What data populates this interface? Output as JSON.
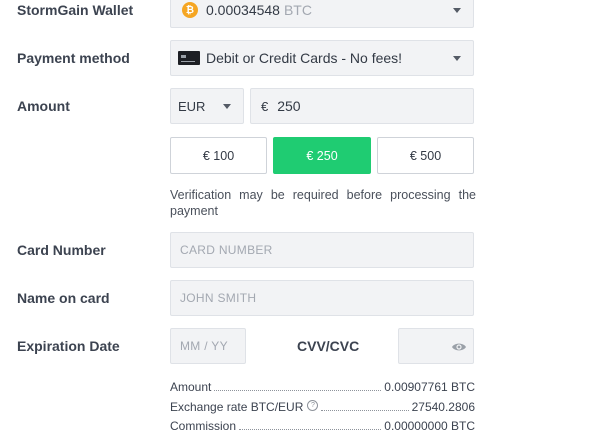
{
  "wallet": {
    "label": "StormGain Wallet",
    "coin_glyph": "₿",
    "balance": "0.00034548",
    "currency": "BTC"
  },
  "payment": {
    "label": "Payment method",
    "value": "Debit or Credit Cards - No fees!"
  },
  "amount": {
    "label": "Amount",
    "currency": "EUR",
    "symbol": "€",
    "value": "250",
    "presets": [
      "€ 100",
      "€ 250",
      "€ 500"
    ],
    "active_preset": 1
  },
  "note": "Verification may be required before processing the payment",
  "card_number": {
    "label": "Card Number",
    "placeholder": "CARD NUMBER"
  },
  "name_on_card": {
    "label": "Name on card",
    "placeholder": "JOHN SMITH"
  },
  "expiration": {
    "label": "Expiration Date",
    "placeholder": "MM / YY"
  },
  "cvv": {
    "label": "CVV/CVC"
  },
  "summary": {
    "amount_label": "Amount",
    "amount_value": "0.00907761 BTC",
    "rate_label": "Exchange rate BTC/EUR",
    "rate_value": "27540.2806",
    "commission_label": "Commission",
    "commission_value": "0.00000000 BTC"
  },
  "colors": {
    "accent": "#1fcc72",
    "field_bg": "#f2f3f5",
    "bitcoin": "#f5a623"
  },
  "icons": [
    "bitcoin-icon",
    "card-icon",
    "chevron-down-icon",
    "eye-icon",
    "info-icon"
  ]
}
